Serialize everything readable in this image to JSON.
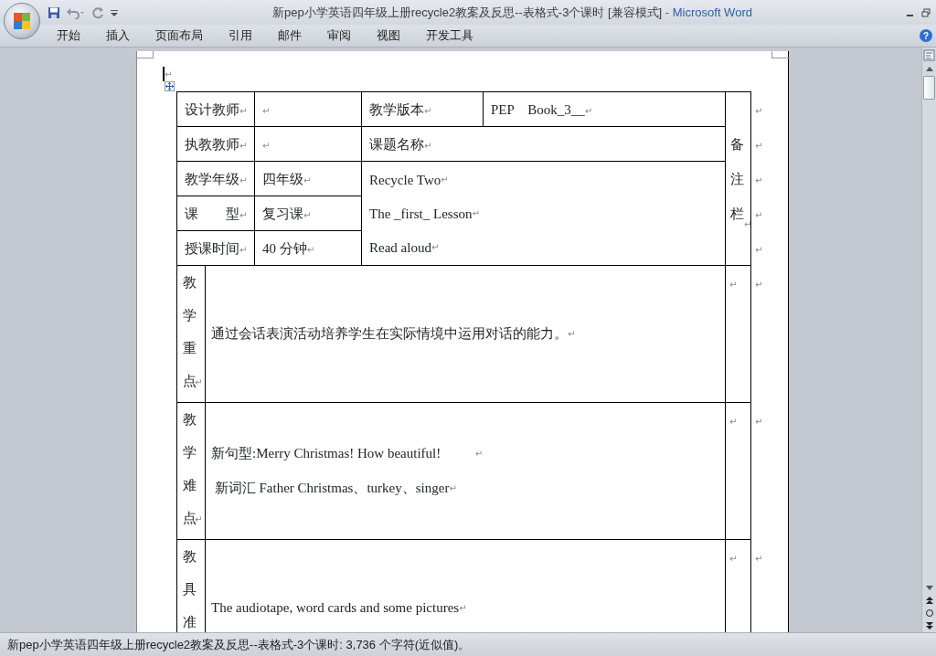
{
  "window": {
    "title": "新pep小学英语四年级上册recycle2教案及反思--表格式-3个课时 [兼容模式]",
    "app": "- Microsoft Word"
  },
  "ribbon_tabs": [
    {
      "label": "开始"
    },
    {
      "label": "插入"
    },
    {
      "label": "页面布局"
    },
    {
      "label": "引用"
    },
    {
      "label": "邮件"
    },
    {
      "label": "审阅"
    },
    {
      "label": "视图"
    },
    {
      "label": "开发工具"
    }
  ],
  "help": "?",
  "document": {
    "first_mark": "↵",
    "info_table": {
      "labels": [
        {
          "text": "设计教师",
          "mark": "↵"
        },
        {
          "text": "执教教师",
          "mark": "↵"
        },
        {
          "text": "教学年级",
          "mark": "↵"
        },
        {
          "text": "课        型",
          "mark": "↵"
        },
        {
          "text": "授课时间",
          "mark": "↵"
        }
      ],
      "values": [
        {
          "mark": "↵"
        },
        {
          "mark": "↵"
        },
        {
          "text": "四年级",
          "mark": "↵"
        },
        {
          "text": "复习课",
          "mark": "↵"
        },
        {
          "text": "40 分钟",
          "mark": "↵"
        }
      ],
      "edition": {
        "label": "教学版本",
        "label_mark": "↵",
        "value": "PEP    Book_3__",
        "value_mark": "↵"
      },
      "topic": {
        "label": "课题名称",
        "mark": "↵"
      },
      "topic_lines": [
        {
          "text": "Recycle Two",
          "mark": "↵"
        },
        {
          "text": "The _first_ Lesson",
          "mark": "↵"
        },
        {
          "text": "Read aloud",
          "mark": "↵"
        }
      ],
      "remarks": {
        "text": "备注栏",
        "mark": "↵"
      },
      "row_marks": [
        "↵",
        "↵",
        "↵",
        "↵",
        "↵"
      ]
    },
    "sections": [
      {
        "label": "教学重点",
        "label_mark": "↵",
        "lines": [
          {
            "text": "通过会话表演活动培养学生在实际情境中运用对话的能力。",
            "mark": "↵"
          }
        ],
        "side_mark": "↵",
        "row_mark": "↵"
      },
      {
        "label": "教学难点",
        "label_mark": "↵",
        "lines": [
          {
            "text": "新句型:Merry Christmas! How beautiful!          ",
            "mark": "↵"
          },
          {
            "text": " 新词汇 Father Christmas、turkey、singer",
            "mark": "↵"
          }
        ],
        "side_mark": "↵",
        "row_mark": "↵"
      },
      {
        "label": "教具准",
        "lines": [
          {
            "text": "The audiotape, word cards and some pictures",
            "mark": "↵"
          }
        ],
        "side_mark": "↵",
        "row_mark": "↵"
      }
    ]
  },
  "status_bar": "新pep小学英语四年级上册recycle2教案及反思--表格式-3个课时: 3,736 个字符(近似值)。"
}
